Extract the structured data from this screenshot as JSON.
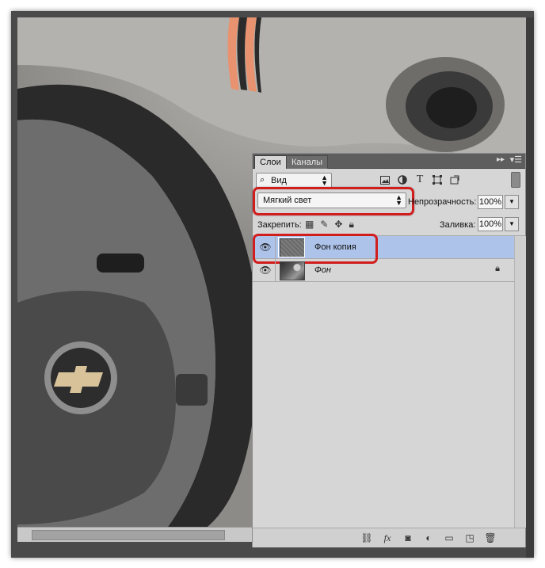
{
  "panel": {
    "tabs": [
      {
        "label": "Слои",
        "active": true
      },
      {
        "label": "Каналы",
        "active": false
      }
    ],
    "expand_icon": "double-arrow-icon",
    "menu_icon": "panel-menu-icon",
    "filter": {
      "search_icon": "search-icon",
      "kind_label": "Вид",
      "icons": [
        "image-filter-icon",
        "adjustment-filter-icon",
        "type-filter-icon",
        "shape-filter-icon",
        "smart-object-filter-icon"
      ]
    },
    "blend_mode": "Мягкий свет",
    "opacity_label": "Непрозрачность:",
    "opacity_value": "100%",
    "lock_label": "Закрепить:",
    "lock_icons": [
      "lock-transparent-icon",
      "lock-image-icon",
      "lock-position-icon",
      "lock-all-icon"
    ],
    "fill_label": "Заливка:",
    "fill_value": "100%",
    "layers": [
      {
        "name": "Фон копия",
        "visible": true,
        "selected": true,
        "italic": false,
        "locked": false
      },
      {
        "name": "Фон",
        "visible": true,
        "selected": false,
        "italic": true,
        "locked": true
      }
    ],
    "bottom_icons": [
      "link-layers-icon",
      "fx-icon",
      "add-mask-icon",
      "adjustment-layer-icon",
      "new-group-icon",
      "new-layer-icon",
      "trash-icon"
    ],
    "highlight_color": "#d21d1d",
    "selection_color": "#adc3ea"
  }
}
